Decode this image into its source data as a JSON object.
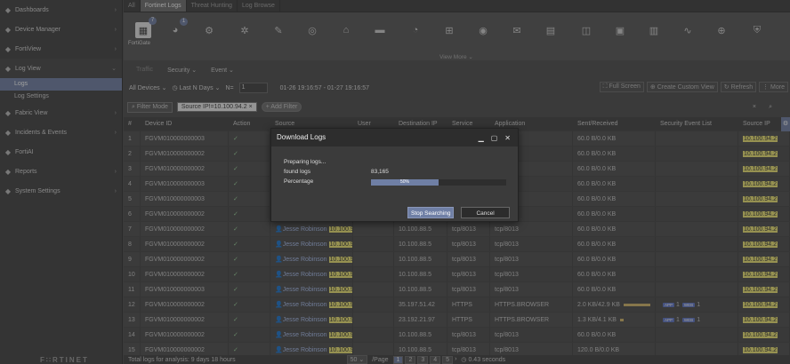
{
  "sidebar": {
    "items": [
      {
        "label": "Dashboards",
        "icon": "dashboard-icon"
      },
      {
        "label": "Device Manager",
        "icon": "device-icon"
      },
      {
        "label": "FortiView",
        "icon": "fortiview-icon"
      },
      {
        "label": "Log View",
        "icon": "log-icon"
      },
      {
        "label": "Fabric View",
        "icon": "fabric-icon"
      },
      {
        "label": "Incidents & Events",
        "icon": "incidents-icon"
      },
      {
        "label": "FortiAI",
        "icon": "ai-icon"
      },
      {
        "label": "Reports",
        "icon": "reports-icon"
      },
      {
        "label": "System Settings",
        "icon": "settings-icon"
      }
    ],
    "subitems": [
      "Logs",
      "Log Settings"
    ],
    "logo": "F∷RTINET"
  },
  "tabs": [
    "All",
    "Fortinet Logs",
    "Threat Hunting",
    "Log Browse"
  ],
  "iconbar": {
    "badge1": "7",
    "badge2": "1",
    "fortigate_label": "FortiGate",
    "view_more": "View More"
  },
  "filters": {
    "traffic": "Traffic",
    "security": "Security",
    "event": "Event"
  },
  "toolbar": {
    "devices": "All Devices",
    "period": "Last N Days",
    "n_label": "N=",
    "n_value": "1",
    "range": "01-26 19:16:57 - 01-27 19:16:57",
    "full_screen": "Full Screen",
    "create_view": "Create Custom View",
    "refresh": "Refresh",
    "more": "More"
  },
  "filterbar": {
    "mode": "Filter Mode",
    "filter": "Source IP!=10.100.94.2",
    "add": "Add Filter"
  },
  "table": {
    "headers": [
      "#",
      "Device ID",
      "Action",
      "Source",
      "User",
      "Destination IP",
      "Service",
      "Application",
      "Sent/Received",
      "Security Event List",
      "Source IP"
    ],
    "rows": [
      {
        "n": "1",
        "dev": "FGVM010000000003",
        "src_user": "",
        "src_ip": "",
        "dst": "",
        "svc": "",
        "app": "",
        "sr": "60.0 B/0.0 KB",
        "sip": "10.100.94.2"
      },
      {
        "n": "2",
        "dev": "FGVM010000000002",
        "src_user": "",
        "src_ip": "",
        "dst": "",
        "svc": "",
        "app": "",
        "sr": "60.0 B/0.0 KB",
        "sip": "10.100.94.2"
      },
      {
        "n": "3",
        "dev": "FGVM010000000002",
        "src_user": "",
        "src_ip": "",
        "dst": "",
        "svc": "",
        "app": "",
        "sr": "60.0 B/0.0 KB",
        "sip": "10.100.94.2"
      },
      {
        "n": "4",
        "dev": "FGVM010000000003",
        "src_user": "",
        "src_ip": "",
        "dst": "",
        "svc": "",
        "app": "",
        "sr": "60.0 B/0.0 KB",
        "sip": "10.100.94.2"
      },
      {
        "n": "5",
        "dev": "FGVM010000000003",
        "src_user": "",
        "src_ip": "",
        "dst": "",
        "svc": "",
        "app": "",
        "sr": "60.0 B/0.0 KB",
        "sip": "10.100.94.2"
      },
      {
        "n": "6",
        "dev": "FGVM010000000002",
        "src_user": "",
        "src_ip": "",
        "dst": "",
        "svc": "",
        "app": "",
        "sr": "60.0 B/0.0 KB",
        "sip": "10.100.94.2"
      },
      {
        "n": "7",
        "dev": "FGVM010000000002",
        "src_user": "Jesse Robinson",
        "src_ip": "10.100.94",
        "dst": "10.100.88.5",
        "svc": "tcp/8013",
        "app": "tcp/8013",
        "sr": "60.0 B/0.0 KB",
        "sip": "10.100.94.2"
      },
      {
        "n": "8",
        "dev": "FGVM010000000002",
        "src_user": "Jesse Robinson",
        "src_ip": "10.100.94",
        "dst": "10.100.88.5",
        "svc": "tcp/8013",
        "app": "tcp/8013",
        "sr": "60.0 B/0.0 KB",
        "sip": "10.100.94.2"
      },
      {
        "n": "9",
        "dev": "FGVM010000000002",
        "src_user": "Jesse Robinson",
        "src_ip": "10.100.94",
        "dst": "10.100.88.5",
        "svc": "tcp/8013",
        "app": "tcp/8013",
        "sr": "60.0 B/0.0 KB",
        "sip": "10.100.94.2"
      },
      {
        "n": "10",
        "dev": "FGVM010000000002",
        "src_user": "Jesse Robinson",
        "src_ip": "10.100.94",
        "dst": "10.100.88.5",
        "svc": "tcp/8013",
        "app": "tcp/8013",
        "sr": "60.0 B/0.0 KB",
        "sip": "10.100.94.2"
      },
      {
        "n": "11",
        "dev": "FGVM010000000003",
        "src_user": "Jesse Robinson",
        "src_ip": "10.100.94",
        "dst": "10.100.88.5",
        "svc": "tcp/8013",
        "app": "tcp/8013",
        "sr": "60.0 B/0.0 KB",
        "sip": "10.100.94.2"
      },
      {
        "n": "12",
        "dev": "FGVM010000000002",
        "src_user": "Jesse Robinson",
        "src_ip": "10.100.94",
        "dst": "35.197.51.42",
        "svc": "HTTPS",
        "app": "HTTPS.BROWSER",
        "sr": "2.0 KB/42.9 KB",
        "sip": "10.100.94.2",
        "tags": [
          "APP",
          "1",
          "WEB",
          "1"
        ]
      },
      {
        "n": "13",
        "dev": "FGVM010000000002",
        "src_user": "Jesse Robinson",
        "src_ip": "10.100.94",
        "dst": "23.192.21.97",
        "svc": "HTTPS",
        "app": "HTTPS.BROWSER",
        "sr": "1.3 KB/4.1 KB",
        "sip": "10.100.94.2",
        "tags": [
          "APP",
          "1",
          "WEB",
          "1"
        ]
      },
      {
        "n": "14",
        "dev": "FGVM010000000002",
        "src_user": "Jesse Robinson",
        "src_ip": "10.100.94",
        "dst": "10.100.88.5",
        "svc": "tcp/8013",
        "app": "tcp/8013",
        "sr": "60.0 B/0.0 KB",
        "sip": "10.100.94.2"
      },
      {
        "n": "15",
        "dev": "FGVM010000000002",
        "src_user": "Jesse Robinson",
        "src_ip": "10.100.94",
        "dst": "10.100.88.5",
        "svc": "tcp/8013",
        "app": "tcp/8013",
        "sr": "120.0 B/0.0 KB",
        "sip": "10.100.94.2"
      }
    ]
  },
  "status": {
    "total": "Total logs for analysis: 9 days 18 hours",
    "per_page": "50",
    "page_label": "/Page",
    "pages": [
      "1",
      "2",
      "3",
      "4",
      "5"
    ],
    "time": "0.43 seconds"
  },
  "dialog": {
    "title": "Download Logs",
    "preparing": "Preparing logs...",
    "found_label": "found logs",
    "found_value": "83,165",
    "pct_label": "Percentage",
    "pct_value": "50%",
    "progress": 0.5,
    "stop": "Stop Searching",
    "cancel": "Cancel"
  }
}
